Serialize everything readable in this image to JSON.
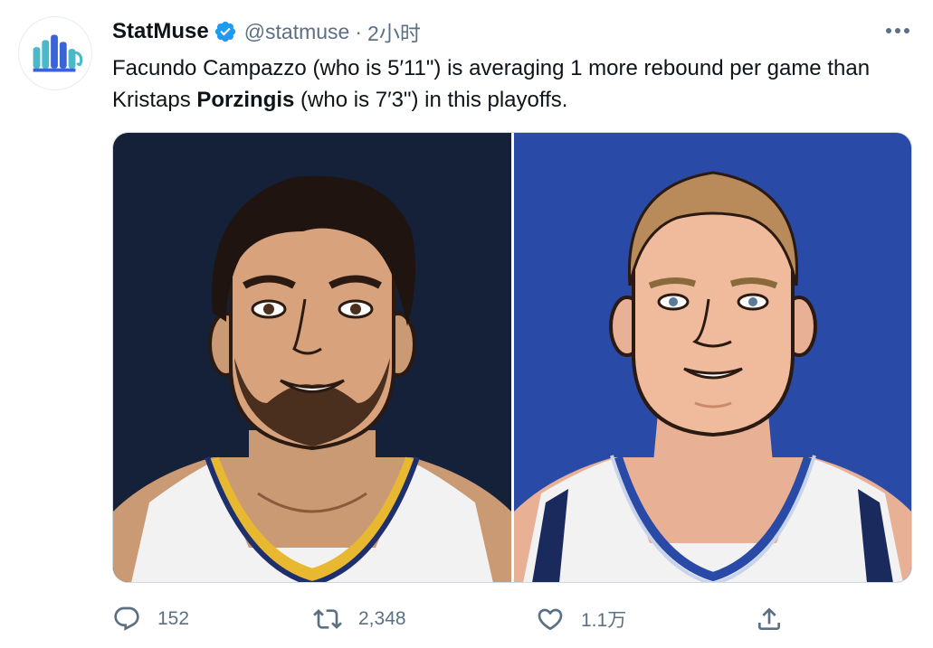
{
  "tweet": {
    "author_name": "StatMuse",
    "handle": "@statmuse",
    "separator": "·",
    "time": "2小时",
    "text_before": "Facundo Campazzo (who is 5′11\") is averaging 1 more rebound per game than Kristaps ",
    "text_bold": "Porzingis",
    "text_after": " (who is 7′3\") in this playoffs."
  },
  "actions": {
    "reply_count": "152",
    "retweet_count": "2,348",
    "like_count": "1.1万"
  },
  "icons": {
    "verified": "verified-badge-icon",
    "more": "more-horizontal-icon",
    "reply": "reply-bubble-icon",
    "retweet": "retweet-icon",
    "like": "heart-icon",
    "share": "share-upload-icon"
  },
  "colors": {
    "verified_blue": "#1d9bf0",
    "muted_text": "#5b7083",
    "left_panel_bg": "#152039",
    "right_panel_bg": "#2a4aa8",
    "logo_blue": "#3a63d8",
    "logo_teal": "#4ab8c8"
  }
}
